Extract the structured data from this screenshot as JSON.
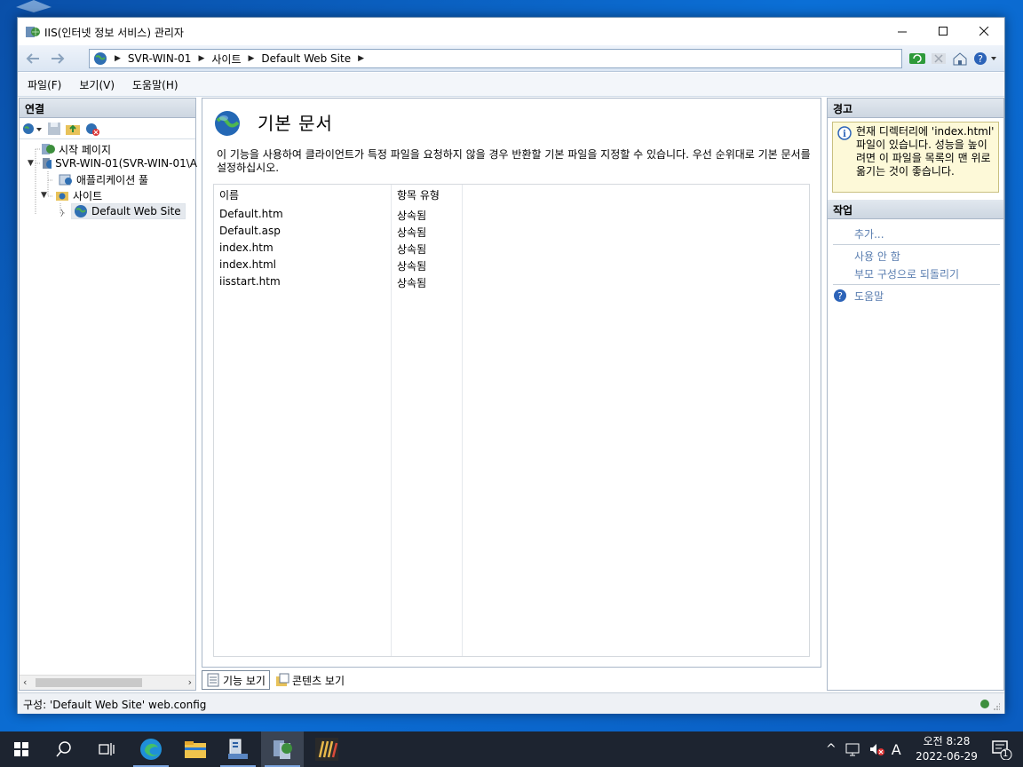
{
  "window": {
    "title": "IIS(인터넷 정보 서비스) 관리자"
  },
  "address": {
    "segments": [
      "SVR-WIN-01",
      "사이트",
      "Default Web Site"
    ]
  },
  "menu": [
    "파일(F)",
    "보기(V)",
    "도움말(H)"
  ],
  "connections": {
    "header": "연결",
    "tree": {
      "start_page": "시작 페이지",
      "server": "SVR-WIN-01(SVR-WIN-01\\A",
      "app_pools": "애플리케이션 풀",
      "sites": "사이트",
      "default_site": "Default Web Site"
    }
  },
  "feature": {
    "title": "기본 문서",
    "description": "이 기능을 사용하여 클라이언트가 특정 파일을 요청하지 않을 경우 반환할 기본 파일을 지정할 수 있습니다. 우선 순위대로 기본 문서를 설정하십시오.",
    "columns": [
      "이름",
      "항목 유형"
    ],
    "rows": [
      {
        "name": "Default.htm",
        "type": "상속됨"
      },
      {
        "name": "Default.asp",
        "type": "상속됨"
      },
      {
        "name": "index.htm",
        "type": "상속됨"
      },
      {
        "name": "index.html",
        "type": "상속됨"
      },
      {
        "name": "iisstart.htm",
        "type": "상속됨"
      }
    ]
  },
  "view_tabs": {
    "features": "기능 보기",
    "content": "콘텐츠 보기"
  },
  "alerts": {
    "header": "경고",
    "message": "현재 디렉터리에 'index.html' 파일이 있습니다. 성능을 높이려면 이 파일을 목록의 맨 위로 옮기는 것이 좋습니다."
  },
  "actions": {
    "header": "작업",
    "add": "추가...",
    "disable": "사용 안 함",
    "revert": "부모 구성으로 되돌리기",
    "help": "도움말"
  },
  "status": {
    "text": "구성: 'Default Web Site' web.config"
  },
  "clock": {
    "time": "오전 8:28",
    "date": "2022-06-29"
  },
  "tray": {
    "ime": "A",
    "notifications": "1"
  },
  "colors": {
    "accent": "#0a5cc0",
    "link": "#5a7eb0",
    "alert_bg": "#fdf9d8",
    "taskbar": "#1d2430"
  }
}
